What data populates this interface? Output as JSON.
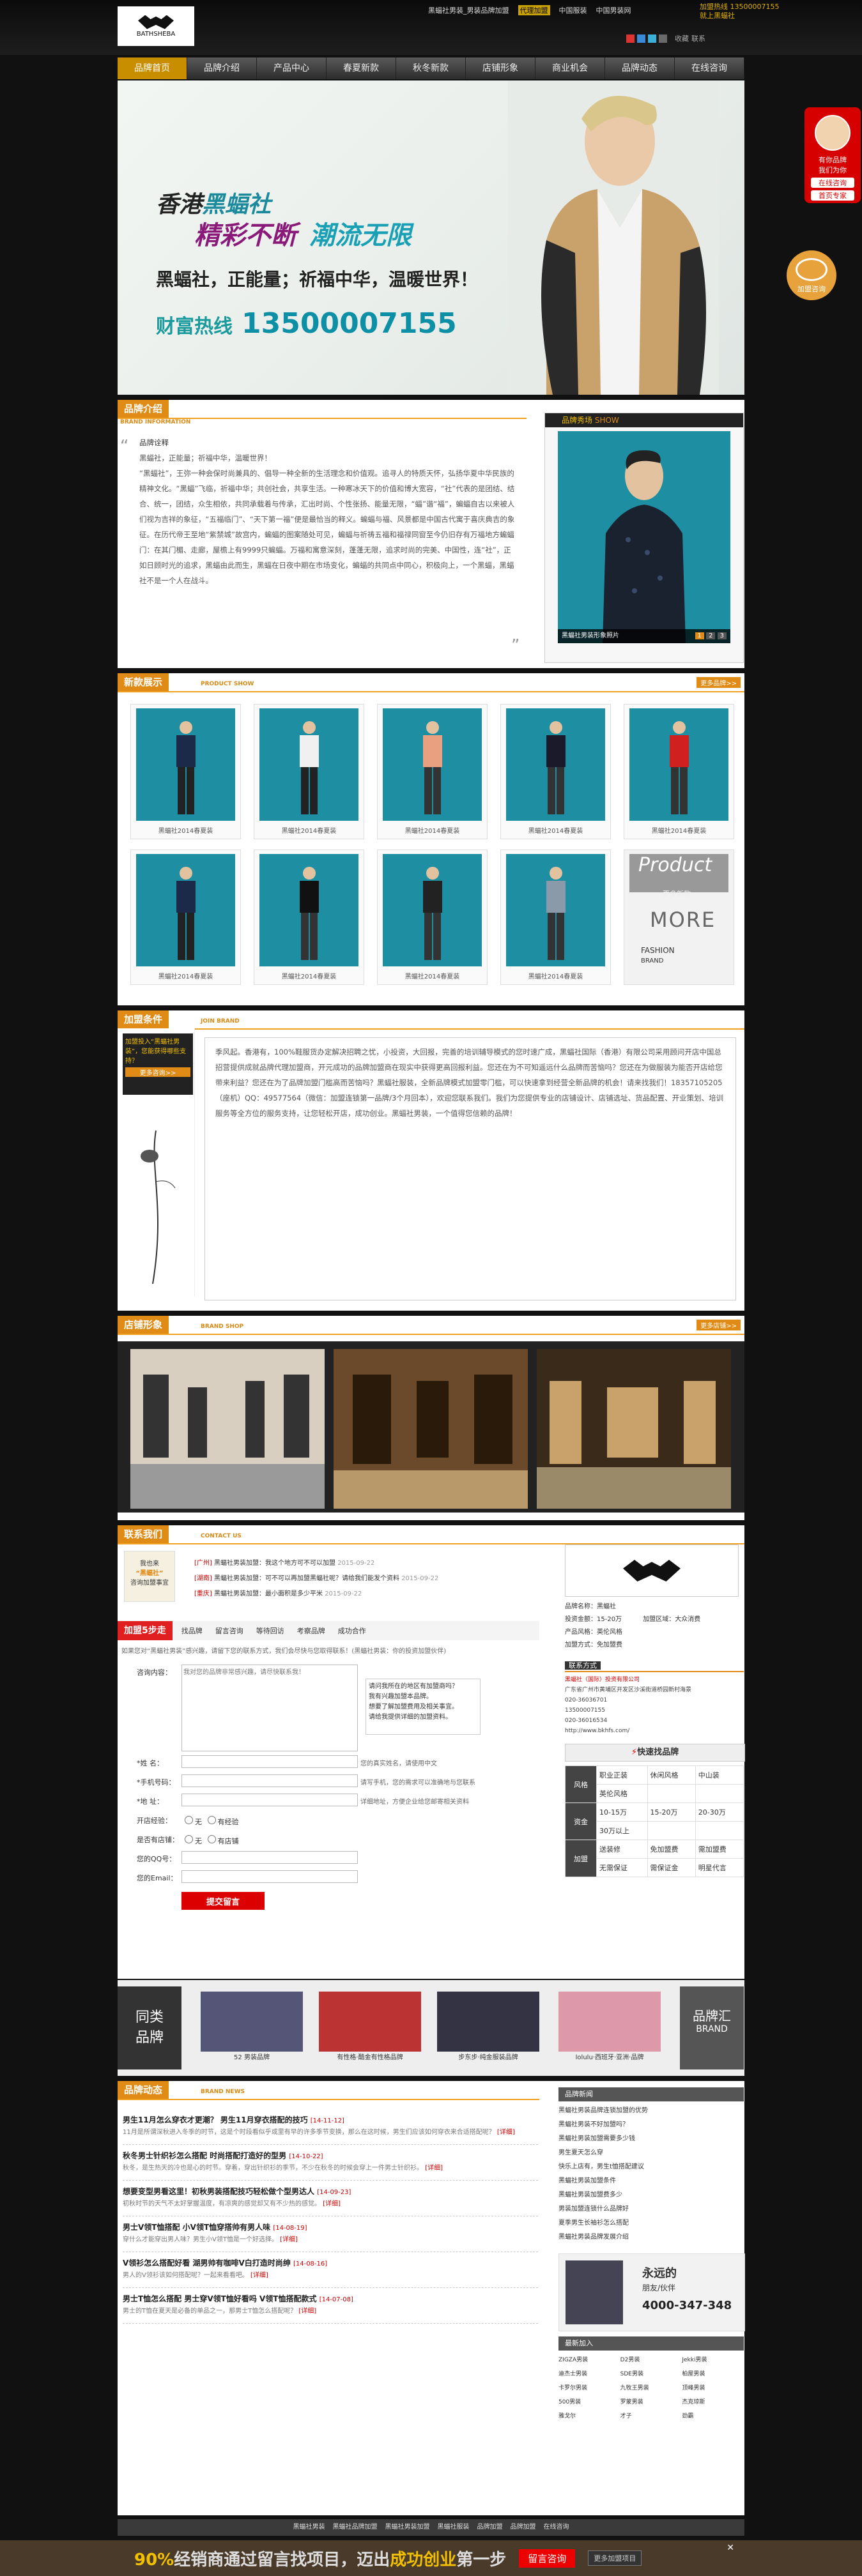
{
  "top": {
    "links": [
      "黑蝠社男装_男装品牌加盟",
      "代理加盟",
      "中国服装",
      "中国男装网"
    ],
    "side": [
      "加盟热线 13500007155",
      "就上黑蝠社"
    ],
    "socials": [
      "收藏",
      "联系"
    ]
  },
  "logo": {
    "en": "BATHSHEBA",
    "cn": "黑蝠社"
  },
  "nav": [
    "品牌首页",
    "品牌介绍",
    "产品中心",
    "春夏新款",
    "秋冬新款",
    "店铺形象",
    "商业机会",
    "品牌动态",
    "在线咨询"
  ],
  "banner": {
    "line1a": "香港",
    "line1b": "黑蝠社",
    "line2a": "精彩不断",
    "line2b": "潮流无限",
    "line3": "黑蝠社，正能量；祈福中华，温暖世界！",
    "hotline_label": "财富热线",
    "hotline": "13500007155"
  },
  "float_right": {
    "title": "有你品牌",
    "subtitle": "我们为你",
    "btn1": "在线咨询",
    "btn2": "首页专家"
  },
  "float_bubble": "加盟咨询",
  "intro": {
    "tag": "品牌介绍",
    "en": "BRAND INFORMATION",
    "heading": "品牌诠释",
    "p1": "黑蝠社，正能量；祈福中华，温暖世界！",
    "p2": "“黑蝠社”，王弥一种会保时尚兼具的、倡导一种全新的生活理念和价值观。追寻人的特质天怀，弘扬华夏中华民族的精神文化。“黑蝠”飞临，祈福中华；共创社会，共享生活。一种寒冰天下的价值和博大宽容，“社”代表的是团结、结合、统一，团结，众生相依，共同承载着与传承，汇出时尚、个性张扬、能量无限，“蝠”谐“福”，蝙蝠自古以来被人们视为吉祥的象征，“五福临门”、“天下第一福”便是最恰当的释义。蝙蝠与福、风景都是中国古代寓于喜庆典吉的象征。在历代帝王至地“紫禁城”故宫内，蝙蝠的图案随处可见，蝙蝠与祈祷五福和福禄同窗至今仍旧存有万福地方蝙蝠门：在其门楣、走廊，屋檐上有9999只蝙蝠。万福和寓意深刻，蓬蓬无限，追求时尚的完美、中国性，连“社”，正如日顾时光的追求，黑蝠由此而生，黑蝠在日夜中期在市场变化，蝙蝠的共同点中同心，积极向上，一个黑蝠，黑蝠社不是一个人在战斗。"
  },
  "show": {
    "tag": "品牌秀场",
    "tag_en": "SHOW",
    "caption": "黑蝠社男装形象照片",
    "pages": [
      "1",
      "2",
      "3"
    ]
  },
  "products": {
    "tag": "新款展示",
    "en": "PRODUCT SHOW",
    "more": "更多品牌>>",
    "items": [
      "黑蝠社2014春夏装",
      "黑蝠社2014春夏装",
      "黑蝠社2014春夏装",
      "黑蝠社2014春夏装",
      "黑蝠社2014春夏装",
      "黑蝠社2014春夏装",
      "黑蝠社2014春夏装",
      "黑蝠社2014春夏装",
      "黑蝠社2014春夏装"
    ],
    "promo": {
      "title": "Product",
      "sub": "更多新款",
      "more": "MORE",
      "f": "FASHION",
      "brand": "BRAND"
    }
  },
  "join": {
    "tag": "加盟条件",
    "en": "JOIN BRAND",
    "side": [
      "加盟投入“黑蝠社男装”，您能获得哪些支持？",
      "更多咨询>>"
    ],
    "text": "季风起。香港有，100%鞋服货办定解决招聘之忧，小投资，大回报，完善的培训辅导模式的您时速广成，黑蝠社国际（香港）有限公司采用顾问开店中国总招营提供成就品牌代理加盟商，开元成功的品牌加盟商在现实中获得更高回报利益。您还在为不可知遥远什么品牌而苦恼吗？您还在为做服装为能否开店给您带来利益？您还在为了品牌加盟门槛高而苦恼吗？黑蝠社服装，全新品牌模式加盟零门槛，可以快速拿到经营全新品牌的机会！请来找我们！18357105205（座机）QQ：49577564（微信：加盟连锁第一品牌/3个月回本），欢迎您联系我们。我们为您提供专业的店铺设计、店铺选址、货品配置、开业策划、培训服务等全方位的服务支持，让您轻松开店，成功创业。黑蝠社男装，一个值得您信赖的品牌！"
  },
  "shop": {
    "tag": "店铺形象",
    "en": "BRAND SHOP",
    "more": "更多店铺>>"
  },
  "contact": {
    "tag": "联系我们",
    "en": "CONTACT US",
    "left_box": [
      "我也来",
      "“黑蝠社”",
      "咨询加盟事宜"
    ],
    "messages": [
      {
        "who": "[广州]",
        "text": "黑蝠社男装加盟：我这个地方可不可以加盟",
        "date": "2015-09-22"
      },
      {
        "who": "[湖南]",
        "text": "黑蝠社男装加盟：可不可以再加盟黑蝠社呢？请给我们能发个资料",
        "date": "2015-09-22"
      },
      {
        "who": "[重庆]",
        "text": "黑蝠社男装加盟：最小面积是多少平米",
        "date": "2015-09-22"
      }
    ],
    "steps_tag": "加盟5步走",
    "steps": [
      "找品牌",
      "留言咨询",
      "等待回访",
      "考察品牌",
      "成功合作"
    ],
    "notice": "如果您对“黑蝠社男装”感兴趣，请留下您的联系方式，我们会尽快与您取得联系！(黑蝠社男装：你的投资加盟伙伴)",
    "form": {
      "content_label": "咨询内容：",
      "content_placeholder": "我对您的品牌非常感兴趣，请尽快联系我！",
      "quick_msgs": [
        "请问我所在的地区有加盟商吗？",
        "我有兴趣加盟本品牌。",
        "想要了解加盟费用及相关事宜。",
        "请给我提供详细的加盟资料。"
      ],
      "fields": [
        {
          "label": "*姓 名：",
          "hint": "您的真实姓名，请使用中文"
        },
        {
          "label": "*手机号码：",
          "hint": "请写手机，您的需求可以准确地与您联系"
        },
        {
          "label": "*地 址：",
          "hint": "详细地址，方便企业给您邮寄相关资料"
        }
      ],
      "shop_label": "开店经验：",
      "shop_opts": [
        "无",
        "有经验"
      ],
      "store_label": "是否有店铺：",
      "store_opts": [
        "无",
        "有店铺"
      ],
      "qq_label": "您的QQ号：",
      "email_label": "您的Email：",
      "submit": "提交留言"
    },
    "side": {
      "brand_name": "品牌名称：",
      "brand": "黑蝠社",
      "invest_label": "投资金额：",
      "invest": "15-20万",
      "region_label": "加盟区域：",
      "region": "大众消费",
      "product_label": "产品风格：",
      "product": "英伦风格",
      "type_label": "加盟方式：",
      "type": "免加盟费",
      "contact_tag": "联系方式",
      "company": "黑蝠社（国际）投资有限公司",
      "addr": "广东省广州市黄埔区开发区沙溪街道桥园新村海景",
      "phone": "020-36036701",
      "tel": "13500007155",
      "fax": "020-36016534",
      "site": "http://www.bkhfs.com/",
      "banner": "快速找品牌",
      "tbl_rows": [
        {
          "h": "风格",
          "cells": [
            "职业正装",
            "休闲风格",
            "中山装",
            "英伦风格"
          ]
        },
        {
          "h": "资金",
          "cells": [
            "10-15万",
            "15-20万",
            "20-30万",
            "30万以上"
          ]
        },
        {
          "h": "加盟",
          "cells": [
            "送装修",
            "免加盟费",
            "需加盟费",
            "无需保证",
            "需保证金",
            "明星代言"
          ]
        }
      ]
    }
  },
  "brands": {
    "left_tag": [
      "同类",
      "品牌"
    ],
    "right_tag": [
      "品牌汇",
      "BRAND"
    ],
    "items": [
      "52 男装品牌",
      "有性格·酷金有性格品牌",
      "步东步·纯金服装品牌",
      "lolulu·西班牙·亚洲·品牌"
    ]
  },
  "news": {
    "tag": "品牌动态",
    "en": "BRAND NEWS",
    "items": [
      {
        "title": "男生11月怎么穿衣才更潮？ 男生11月穿衣搭配的技巧",
        "date": "[14-11-12]",
        "desc": "11月是所谓深秋进入冬季的时节，这是个时段看似乎或里有早的许多季节变换，那么在这时候，男生们应该如何穿衣来合适搭配呢？",
        "more": "[详细]"
      },
      {
        "title": "秋冬男士针织衫怎么搭配 时尚搭配打造好的型男",
        "date": "[14-10-22]",
        "desc": "秋冬，是生热天的冷也是心的时节。穿着，穿出针织衫的季节，不少在秋冬的时候会穿上一件男士针织衫。",
        "more": "[详细]"
      },
      {
        "title": "想要变型男看这里！初秋男装搭配技巧轻松做个型男达人",
        "date": "[14-09-23]",
        "desc": "初秋时节的天气不太好掌握温度，有凉爽的感觉却又有不少热的感觉。",
        "more": "[详细]"
      },
      {
        "title": "男士V领T恤搭配 小V领T恤穿搭帅有男人味",
        "date": "[14-08-19]",
        "desc": "穿什么才能穿出男人味？男生小V领T恤是一个好选择。",
        "more": "[详细]"
      },
      {
        "title": "V领衫怎么搭配好看 湖男帅有咖啡V白打造时尚绅",
        "date": "[14-08-16]",
        "desc": "男人的V领衫该如何搭配呢？一起来看看吧。",
        "more": "[详细]"
      },
      {
        "title": "男士T恤怎么搭配 男士穿V领T恤好看吗 V领T恤搭配款式",
        "date": "[14-07-08]",
        "desc": "男士的T恤在夏天是必备的单品之一，那男士T恤怎么搭配呢？",
        "more": "[详细]"
      }
    ],
    "side_tag": "品牌新闻",
    "side_list": [
      "黑蝠社男装品牌连锁加盟的优势",
      "黑蝠社男装不好加盟吗？",
      "黑蝠社男装加盟需要多少钱",
      "男生夏天怎么穿",
      "快乐上店有，男生t恤搭配建议",
      "黑蝠社男装加盟条件",
      "黑蝠社男装加盟费多少",
      "男装加盟连锁什么品牌好",
      "夏季男生长袖衫怎么搭配",
      "黑蝠社男装品牌发展介绍"
    ],
    "side_ad": [
      "永远的",
      "朋友/伙伴",
      "4000-347-348"
    ],
    "side_tag2": "最新加入",
    "side_grid": [
      "ZIGZA男装",
      "D2男装",
      "Jekki男装",
      "迪杰士男装",
      "SDE男装",
      "柏屋男装",
      "卡罗尔男装",
      "九牧王男装",
      "顶峰男装",
      "500男装",
      "罗蒙男装",
      "杰克琼斯",
      "雅戈尔",
      "才子",
      "劲霸"
    ]
  },
  "footer": [
    "黑蝠社男装",
    "黑蝠社品牌加盟",
    "黑蝠社男装加盟",
    "黑蝠社服装",
    "品牌加盟",
    "品牌加盟",
    "在线咨询"
  ],
  "bottom": {
    "pct": "90%",
    "text1": "经销商通过留言找项目，迈出",
    "highlight": "成功创业",
    "text2": "第一步",
    "btn": "留言咨询",
    "btn2": "更多加盟项目"
  },
  "colors": {
    "accent": "#e08b16",
    "dark": "#111111",
    "teal": "#1e8fa3"
  }
}
